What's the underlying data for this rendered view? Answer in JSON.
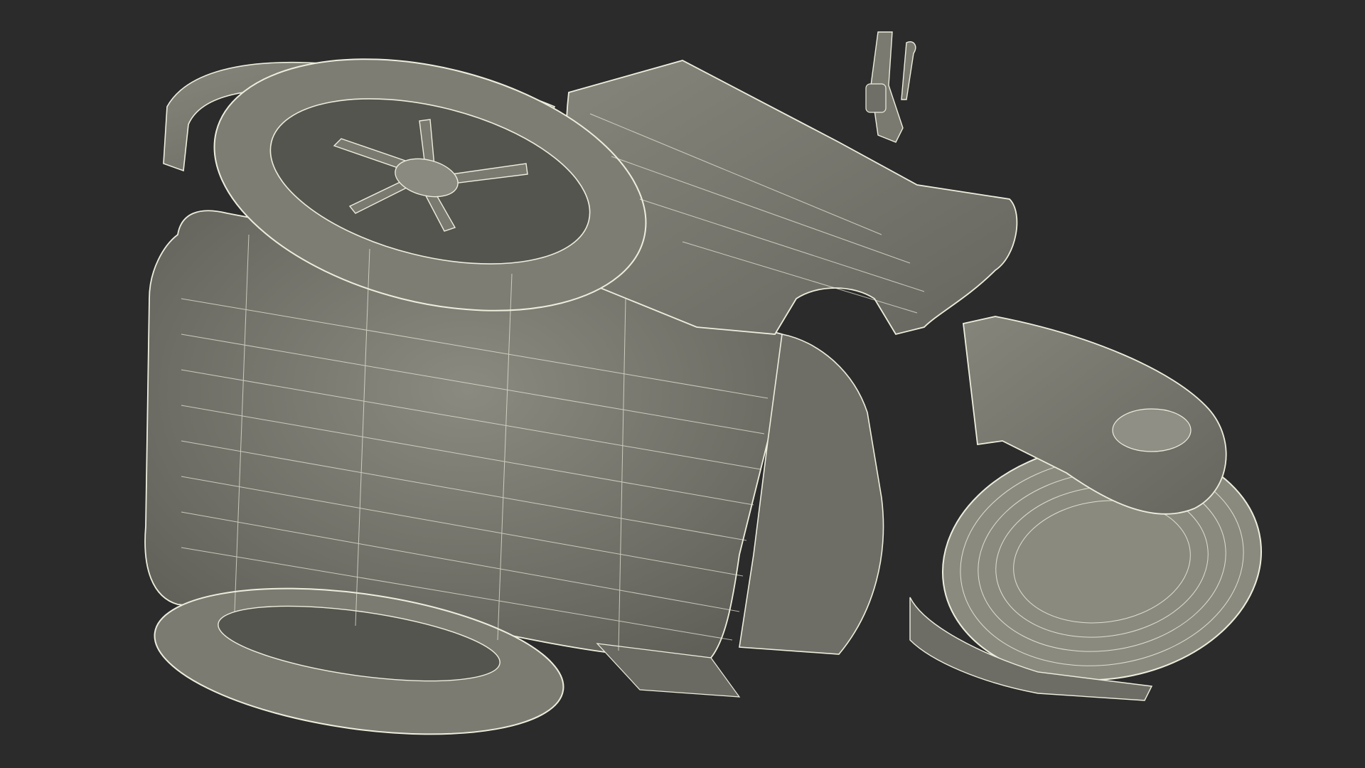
{
  "scene": {
    "background_color": "#2b2b2b",
    "object_fill_color": "#7b7b72",
    "object_shadow_color": "#5e5e57",
    "wire_color": "#eeeede",
    "subject": "wireframe-scooter-model-icon",
    "render_style": "wireframe-over-shaded"
  }
}
